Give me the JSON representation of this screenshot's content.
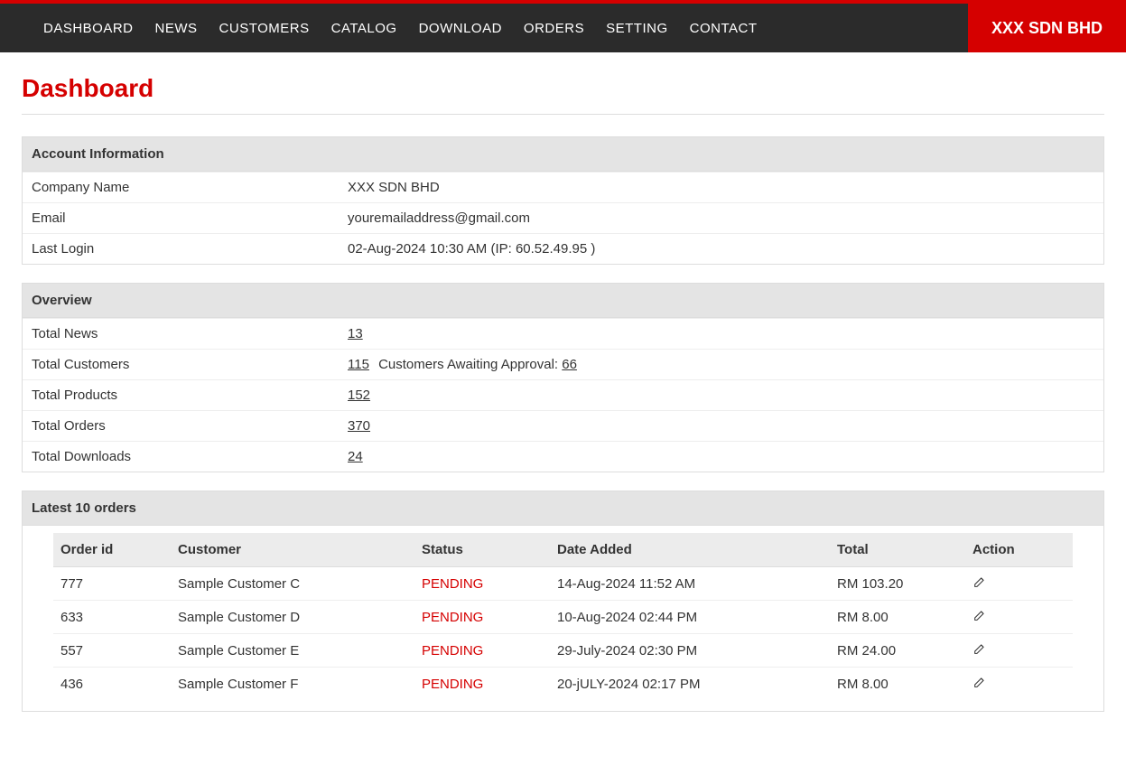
{
  "nav": {
    "items": [
      "DASHBOARD",
      "NEWS",
      "CUSTOMERS",
      "CATALOG",
      "DOWNLOAD",
      "ORDERS",
      "SETTING",
      "CONTACT"
    ],
    "company": "XXX SDN BHD"
  },
  "page": {
    "title": "Dashboard"
  },
  "account": {
    "heading": "Account Information",
    "rows": {
      "company_label": "Company Name",
      "company_value": "XXX SDN BHD",
      "email_label": "Email",
      "email_value": "youremailaddress@gmail.com",
      "lastlogin_label": "Last Login",
      "lastlogin_value": "02-Aug-2024 10:30 AM  (IP: 60.52.49.95 )"
    }
  },
  "overview": {
    "heading": "Overview",
    "news_label": "Total News",
    "news_value": "13",
    "customers_label": "Total Customers",
    "customers_value": "115",
    "customers_awaiting_label": "Customers Awaiting Approval:",
    "customers_awaiting_value": "66",
    "products_label": "Total Products",
    "products_value": "152",
    "orders_label": "Total Orders",
    "orders_value": "370",
    "downloads_label": "Total Downloads",
    "downloads_value": "24"
  },
  "orders_panel": {
    "heading": "Latest 10 orders",
    "columns": {
      "id": "Order id",
      "customer": "Customer",
      "status": "Status",
      "date": "Date Added",
      "total": "Total",
      "action": "Action"
    },
    "rows": [
      {
        "id": "777",
        "customer": "Sample Customer C",
        "status": "PENDING",
        "date": "14-Aug-2024 11:52 AM",
        "total": "RM 103.20"
      },
      {
        "id": "633",
        "customer": "Sample Customer D",
        "status": "PENDING",
        "date": "10-Aug-2024 02:44 PM",
        "total": "RM 8.00"
      },
      {
        "id": "557",
        "customer": "Sample Customer E",
        "status": "PENDING",
        "date": "29-July-2024 02:30 PM",
        "total": "RM 24.00"
      },
      {
        "id": "436",
        "customer": "Sample Customer F",
        "status": "PENDING",
        "date": "20-jULY-2024 02:17 PM",
        "total": "RM 8.00"
      }
    ]
  }
}
